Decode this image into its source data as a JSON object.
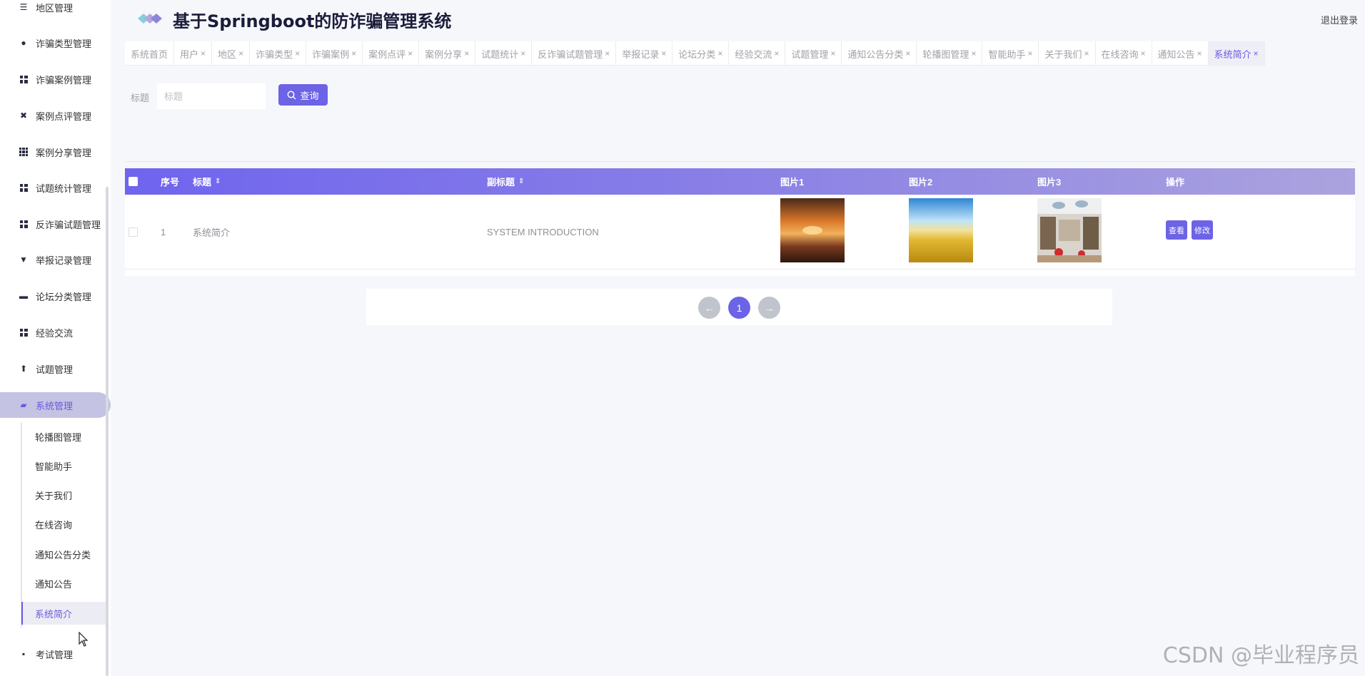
{
  "app": {
    "title": "基于Springboot的防诈骗管理系统",
    "logout": "退出登录"
  },
  "sidebar": {
    "items": [
      {
        "label": "地区管理",
        "icon": "list-icon"
      },
      {
        "label": "诈骗类型管理",
        "icon": "location-icon"
      },
      {
        "label": "诈骗案例管理",
        "icon": "grid-icon"
      },
      {
        "label": "案例点评管理",
        "icon": "ticket-icon"
      },
      {
        "label": "案例分享管理",
        "icon": "grid9-icon"
      },
      {
        "label": "试题统计管理",
        "icon": "grid-icon"
      },
      {
        "label": "反诈骗试题管理",
        "icon": "grid-icon"
      },
      {
        "label": "举报记录管理",
        "icon": "flag-icon"
      },
      {
        "label": "论坛分类管理",
        "icon": "folder-icon"
      },
      {
        "label": "经验交流",
        "icon": "grid-icon"
      },
      {
        "label": "试题管理",
        "icon": "user-icon"
      },
      {
        "label": "系统管理",
        "icon": "thumb-icon"
      }
    ],
    "sub_items": [
      "轮播图管理",
      "智能助手",
      "关于我们",
      "在线咨询",
      "通知公告分类",
      "通知公告",
      "系统简介"
    ],
    "bottom_item": {
      "label": "考试管理",
      "icon": "chat-icon"
    }
  },
  "tabs": [
    {
      "label": "系统首页",
      "closable": false
    },
    {
      "label": "用户",
      "closable": true
    },
    {
      "label": "地区",
      "closable": true
    },
    {
      "label": "诈骗类型",
      "closable": true
    },
    {
      "label": "诈骗案例",
      "closable": true
    },
    {
      "label": "案例点评",
      "closable": true
    },
    {
      "label": "案例分享",
      "closable": true
    },
    {
      "label": "试题统计",
      "closable": true
    },
    {
      "label": "反诈骗试题管理",
      "closable": true
    },
    {
      "label": "举报记录",
      "closable": true
    },
    {
      "label": "论坛分类",
      "closable": true
    },
    {
      "label": "经验交流",
      "closable": true
    },
    {
      "label": "试题管理",
      "closable": true
    },
    {
      "label": "通知公告分类",
      "closable": true
    },
    {
      "label": "轮播图管理",
      "closable": true
    },
    {
      "label": "智能助手",
      "closable": true
    },
    {
      "label": "关于我们",
      "closable": true
    },
    {
      "label": "在线咨询",
      "closable": true
    },
    {
      "label": "通知公告",
      "closable": true
    },
    {
      "label": "系统简介",
      "closable": true,
      "active": true
    }
  ],
  "search": {
    "label": "标题",
    "placeholder": "标题",
    "value": "",
    "button": "查询"
  },
  "table": {
    "columns": [
      "序号",
      "标题",
      "副标题",
      "图片1",
      "图片2",
      "图片3",
      "操作"
    ],
    "rows": [
      {
        "index": "1",
        "title": "系统简介",
        "subtitle": "SYSTEM INTRODUCTION",
        "view": "查看",
        "edit": "修改"
      }
    ]
  },
  "pagination": {
    "prev": "←",
    "current": "1",
    "next": "→"
  },
  "watermark": "CSDN @毕业程序员",
  "colors": {
    "accent": "#6c63e6",
    "sidebar_active_bg": "#c5c3e3",
    "page_bg": "#f5f7fb"
  }
}
